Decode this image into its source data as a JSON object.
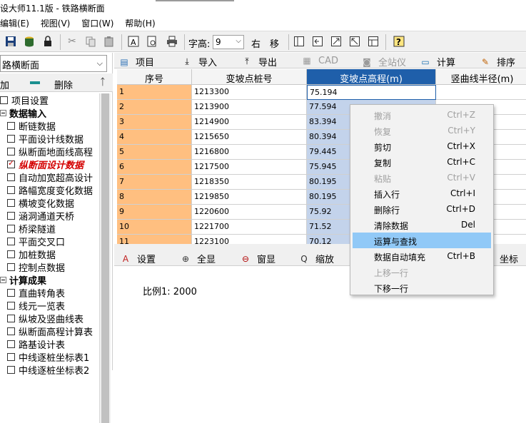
{
  "window": {
    "title": "设大师11.1版 - 铁路横断面"
  },
  "menu": [
    "编辑(E)",
    "视图(V)",
    "窗口(W)",
    "帮助(H)"
  ],
  "toolbar": {
    "font_label": "字高:",
    "font_value": "9",
    "right_label": "右",
    "move_label": "移"
  },
  "left": {
    "combo_value": "路横断面",
    "add_label": "加",
    "delete_label": "删除",
    "pin_icon": "pin-icon",
    "tree": [
      {
        "label": "项目设置",
        "kind": "check",
        "indent": 0,
        "bold": false
      },
      {
        "label": "数据输入",
        "kind": "group",
        "indent": 0,
        "bold": true
      },
      {
        "label": "断链数据",
        "kind": "check",
        "indent": 1,
        "bold": false
      },
      {
        "label": "平面设计线数据",
        "kind": "check",
        "indent": 1,
        "bold": false
      },
      {
        "label": "纵断面地面线高程",
        "kind": "check",
        "indent": 1,
        "bold": false
      },
      {
        "label": "纵断面设计数据",
        "kind": "checked",
        "indent": 1,
        "bold": true,
        "red": true
      },
      {
        "label": "自动加宽超高设计",
        "kind": "check",
        "indent": 1,
        "bold": false
      },
      {
        "label": "路幅宽度变化数据",
        "kind": "check",
        "indent": 1,
        "bold": false
      },
      {
        "label": "横坡变化数据",
        "kind": "check",
        "indent": 1,
        "bold": false
      },
      {
        "label": "涵洞通道天桥",
        "kind": "check",
        "indent": 1,
        "bold": false
      },
      {
        "label": "桥梁隧道",
        "kind": "check",
        "indent": 1,
        "bold": false
      },
      {
        "label": "平面交叉口",
        "kind": "check",
        "indent": 1,
        "bold": false
      },
      {
        "label": "加桩数据",
        "kind": "check",
        "indent": 1,
        "bold": false
      },
      {
        "label": "控制点数据",
        "kind": "check",
        "indent": 1,
        "bold": false
      },
      {
        "label": "计算成果",
        "kind": "group",
        "indent": 0,
        "bold": true
      },
      {
        "label": "直曲转角表",
        "kind": "check",
        "indent": 1,
        "bold": false
      },
      {
        "label": "线元一览表",
        "kind": "check",
        "indent": 1,
        "bold": false
      },
      {
        "label": "纵坡及竖曲线表",
        "kind": "check",
        "indent": 1,
        "bold": false
      },
      {
        "label": "纵断面高程计算表",
        "kind": "check",
        "indent": 1,
        "bold": false
      },
      {
        "label": "路基设计表",
        "kind": "check",
        "indent": 1,
        "bold": false
      },
      {
        "label": "中线逐桩坐标表1",
        "kind": "check",
        "indent": 1,
        "bold": false
      },
      {
        "label": "中线逐桩坐标表2",
        "kind": "check",
        "indent": 1,
        "bold": false
      }
    ]
  },
  "gridtools": [
    {
      "label": "项目",
      "icon": "document-icon",
      "disabled": false
    },
    {
      "label": "导入",
      "icon": "import-icon",
      "disabled": false
    },
    {
      "label": "导出",
      "icon": "export-icon",
      "disabled": false
    },
    {
      "label": "CAD",
      "icon": "cad-icon",
      "disabled": true
    },
    {
      "label": "全站仪",
      "icon": "total-station-icon",
      "disabled": true
    },
    {
      "label": "计算",
      "icon": "calculator-icon",
      "disabled": false
    },
    {
      "label": "排序",
      "icon": "sort-pen-icon",
      "disabled": false
    }
  ],
  "grid": {
    "headers": [
      "序号",
      "变坡点桩号",
      "变坡点高程(m)",
      "竖曲线半径(m)"
    ],
    "rows": [
      [
        "1",
        "1213300",
        "75.194",
        ""
      ],
      [
        "2",
        "1213900",
        "77.594",
        ""
      ],
      [
        "3",
        "1214900",
        "83.394",
        ""
      ],
      [
        "4",
        "1215650",
        "80.394",
        ""
      ],
      [
        "5",
        "1216800",
        "79.445",
        ""
      ],
      [
        "6",
        "1217500",
        "75.945",
        ""
      ],
      [
        "7",
        "1218350",
        "80.195",
        ""
      ],
      [
        "8",
        "1219850",
        "80.195",
        ""
      ],
      [
        "9",
        "1220600",
        "75.92",
        ""
      ],
      [
        "10",
        "1221700",
        "71.52",
        ""
      ],
      [
        "11",
        "1223100",
        "70.12",
        ""
      ]
    ]
  },
  "bottomtools": [
    {
      "label": "设置",
      "icon": "palette-icon"
    },
    {
      "label": "全显",
      "icon": "zoom-extents-icon"
    },
    {
      "label": "窗显",
      "icon": "zoom-window-icon"
    },
    {
      "label": "缩放",
      "icon": "zoom-icon"
    },
    {
      "label": "坐标",
      "icon": ""
    }
  ],
  "canvas": {
    "scale_text": "比例1: 2000"
  },
  "context_menu": [
    {
      "label": "撤消",
      "shortcut": "Ctrl+Z",
      "disabled": true
    },
    {
      "label": "恢复",
      "shortcut": "Ctrl+Y",
      "disabled": true
    },
    {
      "label": "剪切",
      "shortcut": "Ctrl+X",
      "disabled": false
    },
    {
      "label": "复制",
      "shortcut": "Ctrl+C",
      "disabled": false
    },
    {
      "label": "粘贴",
      "shortcut": "Ctrl+V",
      "disabled": true
    },
    {
      "label": "插入行",
      "shortcut": "Ctrl+I",
      "disabled": false
    },
    {
      "label": "删除行",
      "shortcut": "Ctrl+D",
      "disabled": false
    },
    {
      "label": "清除数据",
      "shortcut": "Del",
      "disabled": false
    },
    {
      "label": "运算与查找",
      "shortcut": "",
      "disabled": false,
      "highlighted": true
    },
    {
      "label": "数据自动填充",
      "shortcut": "Ctrl+B",
      "disabled": false
    },
    {
      "label": "上移一行",
      "shortcut": "",
      "disabled": true
    },
    {
      "label": "下移一行",
      "shortcut": "",
      "disabled": false
    }
  ],
  "colors": {
    "seq_col": "#ffbf80",
    "selected_col": "#c3d3eb",
    "header_selected": "#1f5faa",
    "menu_highlight": "#91c9f7"
  }
}
